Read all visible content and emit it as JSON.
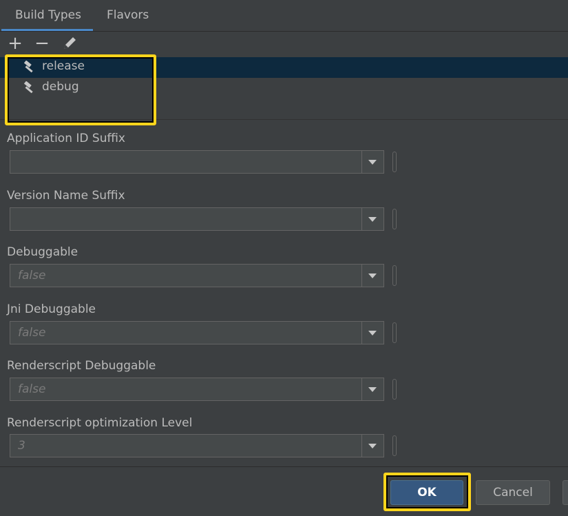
{
  "tabs": [
    {
      "label": "Build Types",
      "selected": true
    },
    {
      "label": "Flavors",
      "selected": false
    }
  ],
  "toolbar": {
    "add_icon": "+",
    "remove_icon": "−",
    "edit_icon": "pencil-icon"
  },
  "build_types": [
    {
      "label": "release",
      "selected": true,
      "icon": "hammer-icon"
    },
    {
      "label": "debug",
      "selected": false,
      "icon": "hammer-icon"
    }
  ],
  "fields": [
    {
      "label": "Application ID Suffix",
      "value": ""
    },
    {
      "label": "Version Name Suffix",
      "value": ""
    },
    {
      "label": "Debuggable",
      "value": "false"
    },
    {
      "label": "Jni Debuggable",
      "value": "false"
    },
    {
      "label": "Renderscript Debuggable",
      "value": "false"
    },
    {
      "label": "Renderscript optimization Level",
      "value": "3"
    }
  ],
  "buttons": {
    "ok": "OK",
    "cancel": "Cancel"
  },
  "colors": {
    "highlight": "#ffd51c",
    "selection": "#0d293e",
    "primary_button": "#365880",
    "tab_underline": "#4a88c7"
  }
}
